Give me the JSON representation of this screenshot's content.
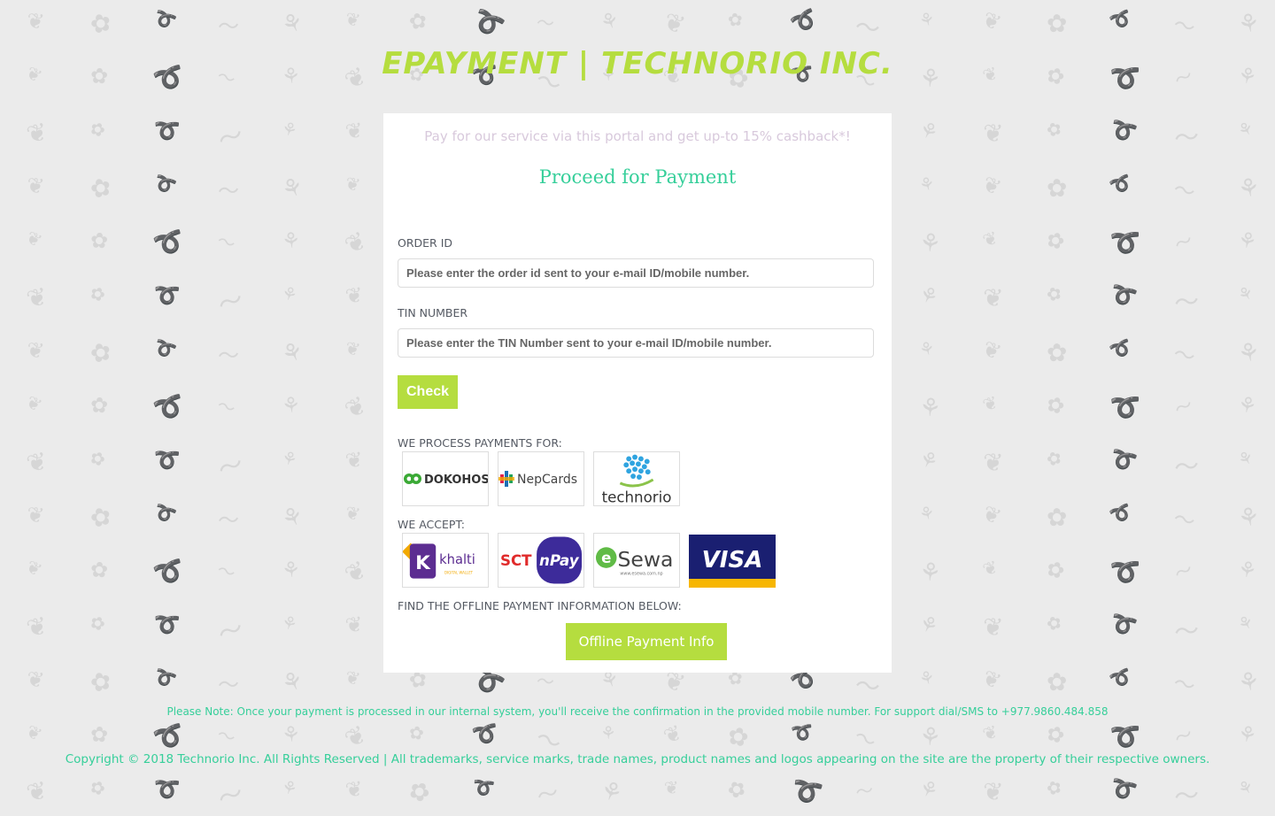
{
  "site": {
    "title": "EPAYMENT | TECHNORIO INC."
  },
  "card": {
    "promo": "Pay for our service via this portal and get up-to 15% cashback*!",
    "heading": "Proceed for Payment",
    "order_id": {
      "label": "ORDER ID",
      "placeholder": "Please enter the order id sent to your e-mail ID/mobile number.",
      "value": ""
    },
    "tin": {
      "label": "TIN NUMBER",
      "placeholder": "Please enter the TIN Number sent to your e-mail ID/mobile number.",
      "value": ""
    },
    "check_label": "Check",
    "process_label": "WE PROCESS PAYMENTS FOR:",
    "process_logos": [
      {
        "icon": "dokohost-logo",
        "text": "DOKOHOST"
      },
      {
        "icon": "nepcards-logo",
        "text": "NepCards"
      },
      {
        "icon": "technorio-logo",
        "text": "technorio"
      }
    ],
    "accept_label": "WE ACCEPT:",
    "accept_logos": [
      {
        "icon": "khalti-logo",
        "text": "khalti",
        "subtext": "DIGITAL WALLET"
      },
      {
        "icon": "sct-npay-logo",
        "text": "SCT nPay"
      },
      {
        "icon": "esewa-logo",
        "text": "eSewa",
        "subtext": "www.esewa.com.np"
      },
      {
        "icon": "visa-logo",
        "text": "VISA"
      }
    ],
    "offline_label": "FIND THE OFFLINE PAYMENT INFORMATION BELOW:",
    "offline_button": "Offline Payment Info"
  },
  "footer": {
    "note": "Please Note: Once your payment is processed in our internal system, you'll receive the confirmation in the provided mobile number. For support dial/SMS to +977.9860.484.858",
    "copyright": "Copyright © 2018 Technorio Inc. All Rights Reserved | All trademarks, service marks, trade names, product names and logos appearing on the site are the property of their respective owners."
  },
  "colors": {
    "accent_green": "#b5dd3f",
    "teal": "#36cf9a",
    "background": "#ebebeb"
  }
}
